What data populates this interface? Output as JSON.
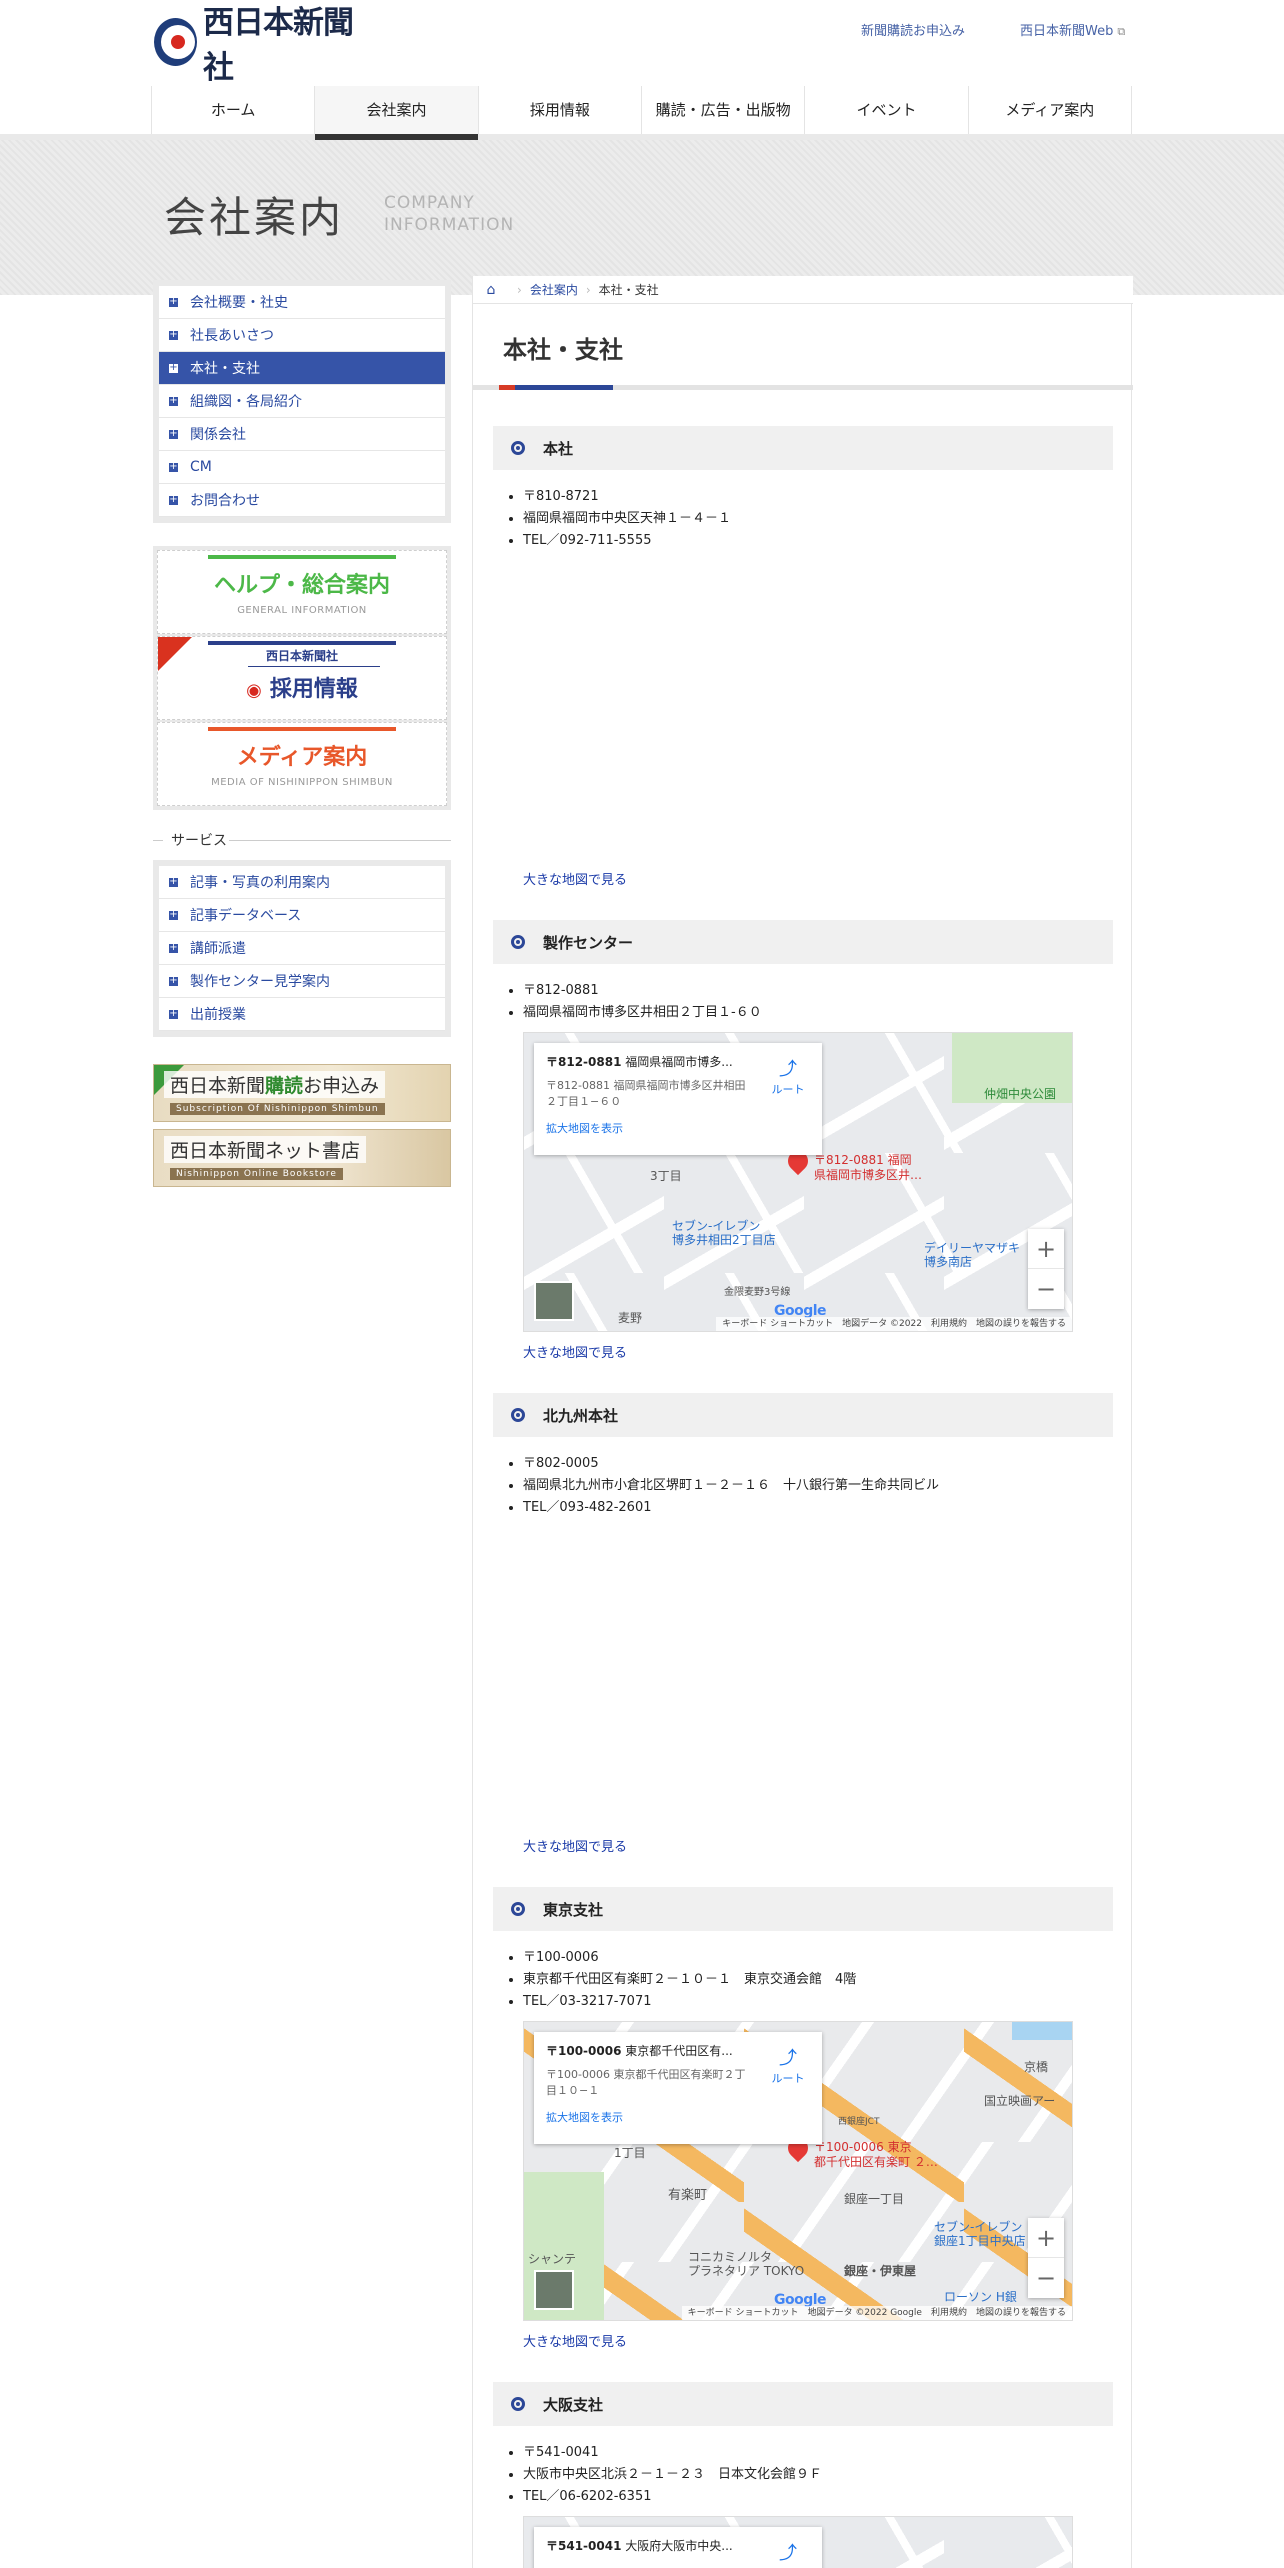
{
  "header": {
    "logo_text": "西日本新聞社",
    "util_links": [
      "新聞購読お申込み",
      "西日本新聞Web"
    ]
  },
  "nav": {
    "items": [
      "ホーム",
      "会社案内",
      "採用情報",
      "購読・広告・出版物",
      "イベント",
      "メディア案内"
    ],
    "active": "会社案内"
  },
  "banner": {
    "title": "会社案内",
    "subtitle_line1": "COMPANY",
    "subtitle_line2": "INFORMATION"
  },
  "sidebar": {
    "company_items": [
      "会社概要・社史",
      "社長あいさつ",
      "本社・支社",
      "組織図・各局紹介",
      "関係会社",
      "CM",
      "お問合わせ"
    ],
    "active_item": "本社・支社",
    "banners": {
      "help_main": "ヘルプ・総合案内",
      "help_en": "GENERAL INFORMATION",
      "recruit_top": "西日本新聞社",
      "recruit_main": "採用情報",
      "media_main": "メディア案内",
      "media_en": "MEDIA OF NISHINIPPON SHIMBUN"
    },
    "service_label": "サービス",
    "service_items": [
      "記事・写真の利用案内",
      "記事データベース",
      "講師派遣",
      "製作センター見学案内",
      "出前授業"
    ],
    "promo1_pre": "西日本新聞",
    "promo1_hl": "購読",
    "promo1_post": "お申込み",
    "promo1_en": "Subscription Of Nishinippon Shimbun",
    "promo2_title": "西日本新聞ネット書店",
    "promo2_en": "Nishinippon Online Bookstore"
  },
  "breadcrumb": {
    "home_icon": "home-icon",
    "parent": "会社案内",
    "current": "本社・支社"
  },
  "page_title": "本社・支社",
  "map_link_label": "大きな地図で見る",
  "map_common": {
    "route": "ルート",
    "enlarge": "拡大地図を表示",
    "shortcut": "キーボード ショートカット",
    "terms": "利用規約",
    "report": "地図の誤りを報告する",
    "google": "Google"
  },
  "sections": [
    {
      "title": "本社",
      "lines": [
        "〒810-8721",
        "福岡県福岡市中央区天神１－４－１",
        "TEL／092-711-5555"
      ]
    },
    {
      "title": "製作センター",
      "lines": [
        "〒812-0881",
        "福岡県福岡市博多区井相田２丁目１-６０"
      ],
      "map": {
        "card_title_bold": "〒812-0881",
        "card_title_rest": " 福岡県福岡市博多...",
        "card_addr": "〒812-0881 福岡県福岡市博多区井相田２丁目１−６０",
        "pin_label_1": "〒812-0881 福岡",
        "pin_label_2": "県福岡市博多区井…",
        "labels": [
          "仲畑中央公園",
          "3丁目",
          "セブン-イレブン",
          "博多井相田2丁目店",
          "デイリーヤマザキ",
          "博多南店",
          "麦野",
          "金隈麦野3号線"
        ],
        "data_notice": "地図データ ©2022"
      }
    },
    {
      "title": "北九州本社",
      "lines": [
        "〒802-0005",
        "福岡県北九州市小倉北区堺町１－２－１６　十八銀行第一生命共同ビル",
        "TEL／093-482-2601"
      ]
    },
    {
      "title": "東京支社",
      "lines": [
        "〒100-0006",
        "東京都千代田区有楽町２－１０－１　東京交通会館　4階",
        "TEL／03-3217-7071"
      ],
      "map": {
        "card_title_bold": "〒100-0006",
        "card_title_rest": " 東京都千代田区有...",
        "card_addr": "〒100-0006 東京都千代田区有楽町２丁目１０−１",
        "pin_label_1": "〒100-0006 東京",
        "pin_label_2": "都千代田区有楽町 ２…",
        "labels": [
          "京橋",
          "国立映画アー",
          "1丁目",
          "有楽町",
          "銀座一丁目",
          "コニカミノルタ",
          "プラネタリア TOKYO",
          "銀座・伊東屋",
          "セブン-イレブン",
          "銀座1丁目中央店",
          "ローソン H銀",
          "シャンテ",
          "西銀座JCT"
        ],
        "data_notice": "地図データ ©2022 Google"
      }
    },
    {
      "title": "大阪支社",
      "lines": [
        "〒541-0041",
        "大阪市中央区北浜２－１－２３　日本文化会館９Ｆ",
        "TEL／06-6202-6351"
      ],
      "map": {
        "card_title_bold": "〒541-0041",
        "card_title_rest": " 大阪府大阪市中央..."
      }
    }
  ]
}
